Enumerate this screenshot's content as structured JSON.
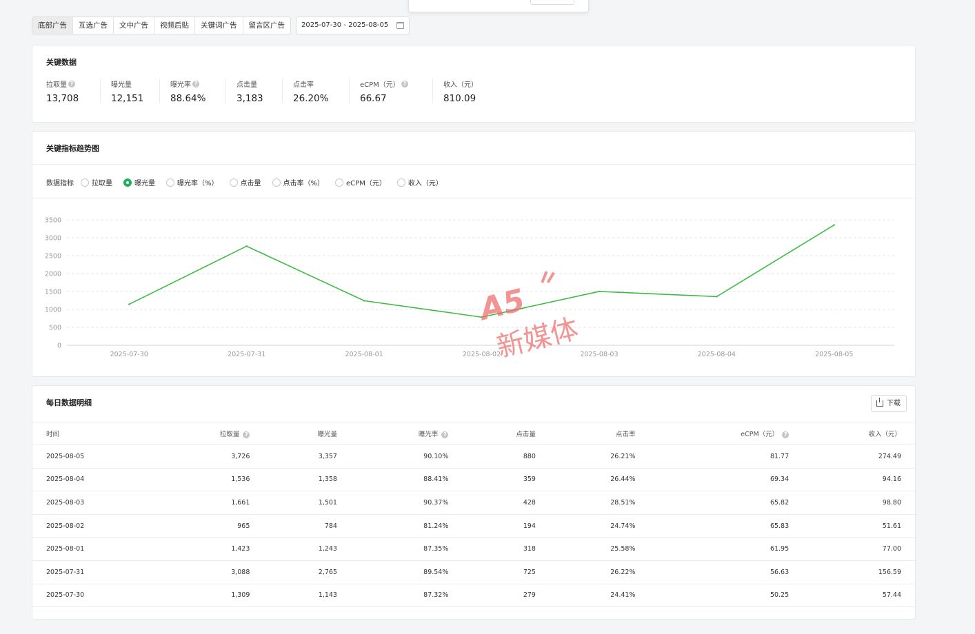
{
  "tabs": [
    {
      "label": "底部广告",
      "active": true
    },
    {
      "label": "互选广告",
      "active": false
    },
    {
      "label": "文中广告",
      "active": false
    },
    {
      "label": "视频后贴",
      "active": false
    },
    {
      "label": "关键词广告",
      "active": false
    },
    {
      "label": "留言区广告",
      "active": false
    }
  ],
  "date_range": "2025-07-30 - 2025-08-05",
  "key_data": {
    "title": "关键数据",
    "metrics": [
      {
        "label": "拉取量",
        "value": "13,708",
        "help": true
      },
      {
        "label": "曝光量",
        "value": "12,151",
        "help": false
      },
      {
        "label": "曝光率",
        "value": "88.64%",
        "help": true
      },
      {
        "label": "点击量",
        "value": "3,183",
        "help": false
      },
      {
        "label": "点击率",
        "value": "26.20%",
        "help": false
      },
      {
        "label": "eCPM（元）",
        "value": "66.67",
        "help": true
      },
      {
        "label": "收入（元）",
        "value": "810.09",
        "help": false
      }
    ]
  },
  "trend": {
    "title": "关键指标趋势图",
    "selector_label": "数据指标",
    "options": [
      {
        "label": "拉取量",
        "checked": false
      },
      {
        "label": "曝光量",
        "checked": true
      },
      {
        "label": "曝光率（%）",
        "checked": false
      },
      {
        "label": "点击量",
        "checked": false
      },
      {
        "label": "点击率（%）",
        "checked": false
      },
      {
        "label": "eCPM（元）",
        "checked": false
      },
      {
        "label": "收入（元）",
        "checked": false
      }
    ]
  },
  "chart_data": {
    "type": "line",
    "x": [
      "2025-07-30",
      "2025-07-31",
      "2025-08-01",
      "2025-08-02",
      "2025-08-03",
      "2025-08-04",
      "2025-08-05"
    ],
    "series": [
      {
        "values": [
          1143,
          2765,
          1243,
          784,
          1501,
          1358,
          3357
        ],
        "color": "#3dbb44"
      }
    ],
    "y_ticks": [
      0,
      500,
      1000,
      1500,
      2000,
      2500,
      3000,
      3500
    ],
    "ylim": [
      0,
      3500
    ],
    "grid": true,
    "title": "",
    "xlabel": "",
    "ylabel": ""
  },
  "watermark": {
    "text": "新媒体",
    "logo": "A5"
  },
  "daily": {
    "title": "每日数据明细",
    "download_label": "下载",
    "columns": [
      {
        "label": "时间",
        "help": false
      },
      {
        "label": "拉取量",
        "help": true
      },
      {
        "label": "曝光量",
        "help": false
      },
      {
        "label": "曝光率",
        "help": true
      },
      {
        "label": "点击量",
        "help": false
      },
      {
        "label": "点击率",
        "help": false
      },
      {
        "label": "eCPM（元）",
        "help": true
      },
      {
        "label": "收入（元）",
        "help": false
      }
    ],
    "rows": [
      [
        "2025-08-05",
        "3,726",
        "3,357",
        "90.10%",
        "880",
        "26.21%",
        "81.77",
        "274.49"
      ],
      [
        "2025-08-04",
        "1,536",
        "1,358",
        "88.41%",
        "359",
        "26.44%",
        "69.34",
        "94.16"
      ],
      [
        "2025-08-03",
        "1,661",
        "1,501",
        "90.37%",
        "428",
        "28.51%",
        "65.82",
        "98.80"
      ],
      [
        "2025-08-02",
        "965",
        "784",
        "81.24%",
        "194",
        "24.74%",
        "65.83",
        "51.61"
      ],
      [
        "2025-08-01",
        "1,423",
        "1,243",
        "87.35%",
        "318",
        "25.58%",
        "61.95",
        "77.00"
      ],
      [
        "2025-07-31",
        "3,088",
        "2,765",
        "89.54%",
        "725",
        "26.22%",
        "56.63",
        "156.59"
      ],
      [
        "2025-07-30",
        "1,309",
        "1,143",
        "87.32%",
        "279",
        "24.41%",
        "50.25",
        "57.44"
      ]
    ]
  }
}
